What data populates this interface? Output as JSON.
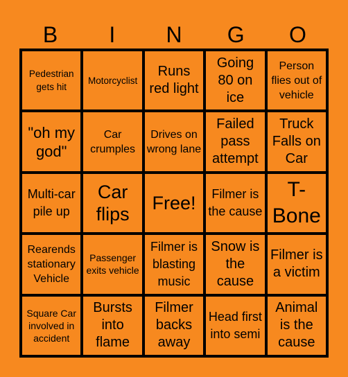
{
  "header": {
    "letters": [
      "B",
      "I",
      "N",
      "G",
      "O"
    ]
  },
  "board": {
    "rows": [
      [
        "Pedestrian gets hit",
        "Motorcyclist",
        "Runs red light",
        "Going 80 on ice",
        "Person flies out of vehicle"
      ],
      [
        "\"oh my god\"",
        "Car crumples",
        "Drives on wrong lane",
        "Failed pass attempt",
        "Truck Falls on Car"
      ],
      [
        "Multi-car pile up",
        "Car flips",
        "Free!",
        "Filmer is the cause",
        "T-Bone"
      ],
      [
        "Rearends stationary Vehicle",
        "Passenger exits vehicle",
        "Filmer is blasting music",
        "Snow is the cause",
        "Filmer is a victim"
      ],
      [
        "Square Car involved in accident",
        "Bursts into flame",
        "Filmer backs away",
        "Head first into semi",
        "Animal is the cause"
      ]
    ],
    "free_space": "Free!"
  },
  "colors": {
    "background": "#f7891f",
    "grid_lines": "#000000",
    "text": "#000000"
  }
}
